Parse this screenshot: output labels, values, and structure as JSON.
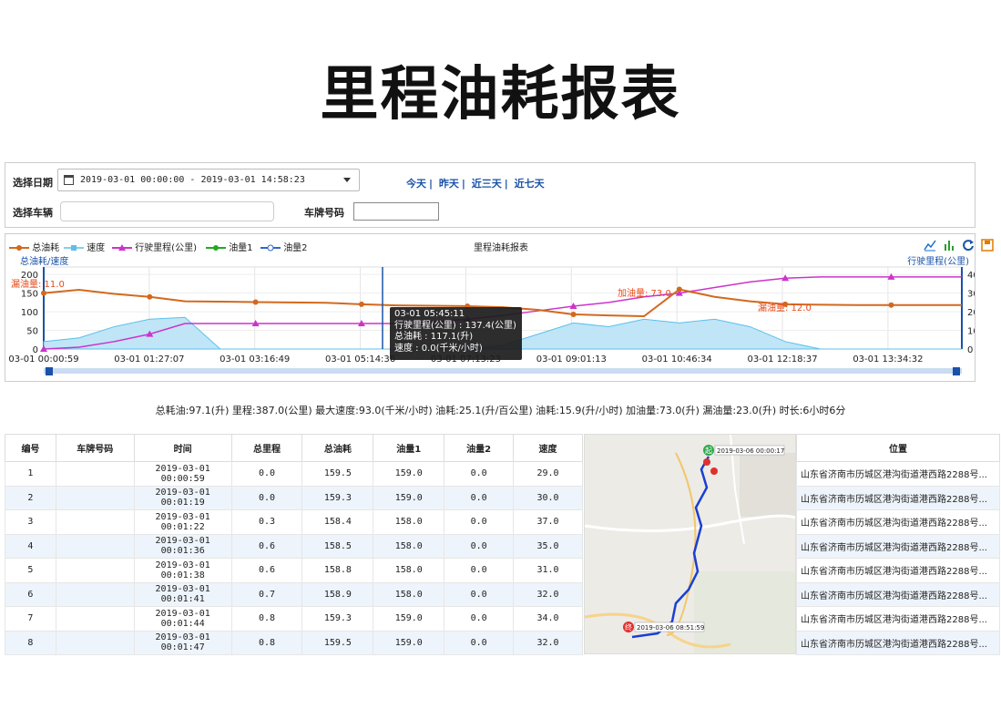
{
  "page_title": "里程油耗报表",
  "filters": {
    "date_label": "选择日期",
    "date_range": "2019-03-01 00:00:00 - 2019-03-01 14:58:23",
    "quick_ranges": [
      "今天",
      "昨天",
      "近三天",
      "近七天"
    ],
    "vehicle_label": "选择车辆",
    "vehicle_value": "",
    "plate_label": "车牌号码",
    "plate_value": ""
  },
  "chart_panel": {
    "title": "里程油耗报表",
    "left_axis_label": "总油耗/速度",
    "right_axis_label": "行驶里程(公里)",
    "icons": [
      "line-chart-icon",
      "bar-chart-icon",
      "refresh-icon",
      "save-icon"
    ],
    "colors": {
      "fuel_total": "#d2691e",
      "speed": "#87ceeb",
      "mileage": "#cc33cc",
      "fuel1": "#22aa22",
      "fuel2": "#3366cc",
      "cursor": "#1a52a8"
    },
    "tooltip": {
      "time": "03-01 05:45:11",
      "line1": "行驶里程(公里) : 137.4(公里)",
      "line2": "总油耗 : 117.1(升)",
      "line3": "速度 : 0.0(千米/小时)"
    },
    "annotations": {
      "leak_left": "漏油量: 11.0",
      "refuel": "加油量: 73.0",
      "leak_right": "漏油量: 12.0"
    }
  },
  "chart_data": {
    "type": "line",
    "title": "里程油耗报表",
    "xlabel": "",
    "ylabel": "总油耗/速度",
    "y2label": "行驶里程(公里)",
    "ylim": [
      0,
      220
    ],
    "y2lim": [
      0,
      440
    ],
    "y_ticks": [
      0,
      50,
      100,
      150,
      200
    ],
    "y2_ticks": [
      0,
      100,
      200,
      300,
      400
    ],
    "x_ticks": [
      "03-01 00:00:59",
      "03-01 01:27:07",
      "03-01 03:16:49",
      "03-01 05:14:36",
      "03-01 07:13:23",
      "03-01 09:01:13",
      "03-01 10:46:34",
      "03-01 12:18:37",
      "03-01 13:34:32"
    ],
    "legend": [
      "总油耗",
      "速度",
      "行驶里程(公里)",
      "油量1",
      "油量2"
    ],
    "legend_position": "top-left",
    "series": [
      {
        "name": "总油耗",
        "axis": "left",
        "values": [
          150,
          159,
          148,
          140,
          128,
          127,
          126,
          125,
          124,
          120,
          117,
          116,
          115,
          112,
          105,
          93,
          90,
          88,
          160,
          140,
          128,
          120,
          119,
          118,
          118,
          118,
          118
        ]
      },
      {
        "name": "行驶里程(公里)",
        "axis": "right",
        "values": [
          0,
          10,
          40,
          80,
          137,
          137,
          137,
          137,
          137,
          137,
          137,
          145,
          160,
          180,
          205,
          230,
          250,
          280,
          300,
          330,
          360,
          380,
          387,
          387,
          387,
          387,
          387
        ]
      },
      {
        "name": "速度",
        "axis": "left",
        "values": [
          20,
          30,
          60,
          80,
          85,
          0,
          0,
          0,
          0,
          0,
          0,
          0,
          0,
          10,
          40,
          70,
          60,
          80,
          70,
          80,
          60,
          20,
          0,
          0,
          0,
          0,
          0
        ]
      }
    ]
  },
  "summary": "总耗油:97.1(升) 里程:387.0(公里) 最大速度:93.0(千米/小时) 油耗:25.1(升/百公里) 油耗:15.9(升/小时) 加油量:73.0(升) 漏油量:23.0(升) 时长:6小时6分",
  "table": {
    "headers": [
      "编号",
      "车牌号码",
      "时间",
      "总里程",
      "总油耗",
      "油量1",
      "油量2",
      "速度"
    ],
    "rows": [
      [
        "1",
        "",
        "2019-03-01 00:00:59",
        "0.0",
        "159.5",
        "159.0",
        "0.0",
        "29.0"
      ],
      [
        "2",
        "",
        "2019-03-01 00:01:19",
        "0.0",
        "159.3",
        "159.0",
        "0.0",
        "30.0"
      ],
      [
        "3",
        "",
        "2019-03-01 00:01:22",
        "0.3",
        "158.4",
        "158.0",
        "0.0",
        "37.0"
      ],
      [
        "4",
        "",
        "2019-03-01 00:01:36",
        "0.6",
        "158.5",
        "158.0",
        "0.0",
        "35.0"
      ],
      [
        "5",
        "",
        "2019-03-01 00:01:38",
        "0.6",
        "158.8",
        "158.0",
        "0.0",
        "31.0"
      ],
      [
        "6",
        "",
        "2019-03-01 00:01:41",
        "0.7",
        "158.9",
        "158.0",
        "0.0",
        "32.0"
      ],
      [
        "7",
        "",
        "2019-03-01 00:01:44",
        "0.8",
        "159.3",
        "159.0",
        "0.0",
        "34.0"
      ],
      [
        "8",
        "",
        "2019-03-01 00:01:47",
        "0.8",
        "159.5",
        "159.0",
        "0.0",
        "32.0"
      ]
    ]
  },
  "map": {
    "start_label": "2019-03-06 00:00:17",
    "end_label": "2019-03-06 08:51:59",
    "start_badge": "起",
    "end_badge": "终"
  },
  "location": {
    "header": "位置",
    "rows": [
      "山东省济南市历城区港沟街道港西路2288号...",
      "山东省济南市历城区港沟街道港西路2288号...",
      "山东省济南市历城区港沟街道港西路2288号...",
      "山东省济南市历城区港沟街道港西路2288号...",
      "山东省济南市历城区港沟街道港西路2288号...",
      "山东省济南市历城区港沟街道港西路2288号...",
      "山东省济南市历城区港沟街道港西路2288号...",
      "山东省济南市历城区港沟街道港西路2288号..."
    ]
  }
}
